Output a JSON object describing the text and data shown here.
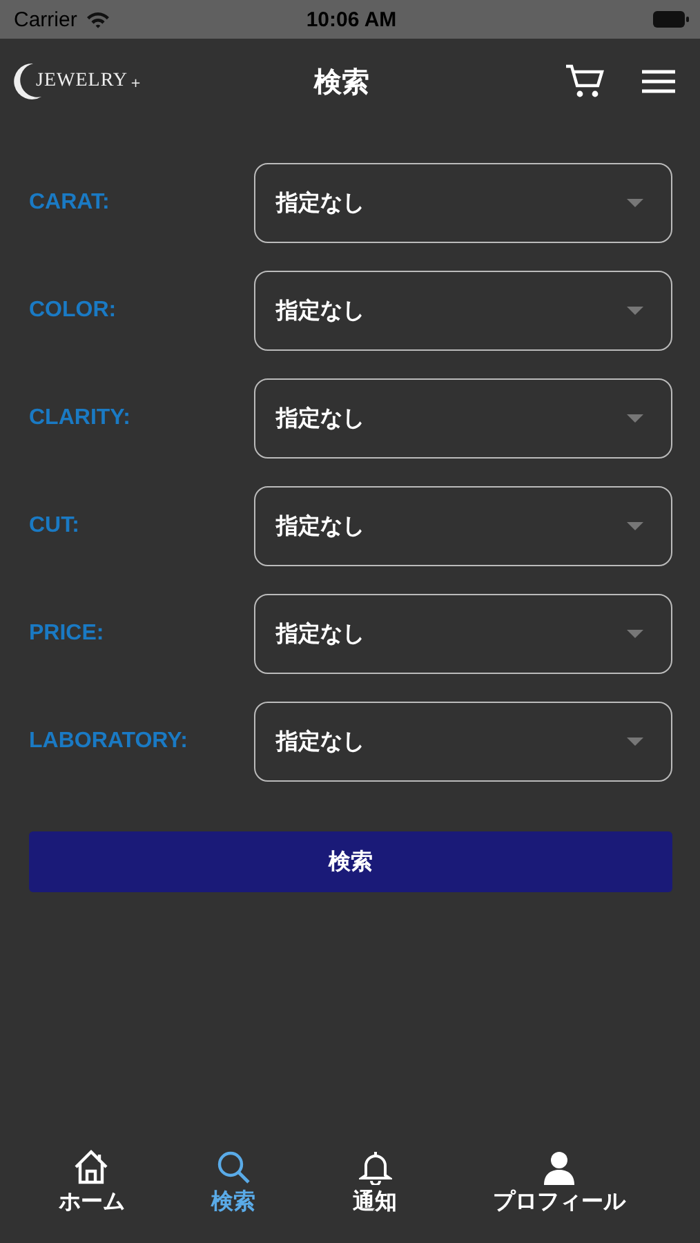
{
  "status_bar": {
    "carrier": "Carrier",
    "time": "10:06 AM"
  },
  "nav": {
    "logo": "JEWELRY",
    "logo_mark": "+",
    "title": "検索"
  },
  "filters": [
    {
      "label": "CARAT:",
      "value": "指定なし"
    },
    {
      "label": "COLOR:",
      "value": "指定なし"
    },
    {
      "label": "CLARITY:",
      "value": "指定なし"
    },
    {
      "label": "CUT:",
      "value": "指定なし"
    },
    {
      "label": "PRICE:",
      "value": "指定なし"
    },
    {
      "label": "LABORATORY:",
      "value": "指定なし"
    }
  ],
  "search_button": "検索",
  "tabs": [
    {
      "kind": "home",
      "label": "ホーム",
      "selected": false
    },
    {
      "kind": "search",
      "label": "検索",
      "selected": true
    },
    {
      "kind": "bell",
      "label": "通知",
      "selected": false
    },
    {
      "kind": "person",
      "label": "プロフィール",
      "selected": false
    }
  ]
}
